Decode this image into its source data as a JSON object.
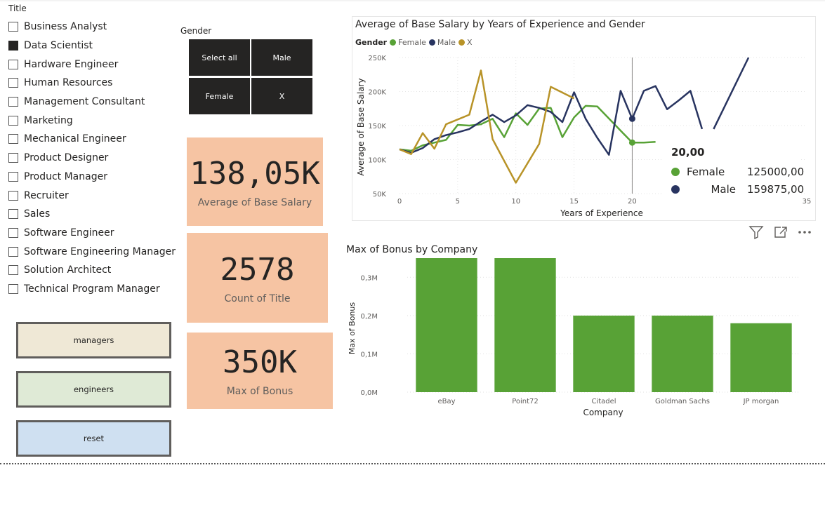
{
  "title_slicer": {
    "header": "Title",
    "items": [
      {
        "label": "Business Analyst",
        "checked": false
      },
      {
        "label": "Data Scientist",
        "checked": true
      },
      {
        "label": "Hardware Engineer",
        "checked": false
      },
      {
        "label": "Human Resources",
        "checked": false
      },
      {
        "label": "Management Consultant",
        "checked": false
      },
      {
        "label": "Marketing",
        "checked": false
      },
      {
        "label": "Mechanical Engineer",
        "checked": false
      },
      {
        "label": "Product Designer",
        "checked": false
      },
      {
        "label": "Product Manager",
        "checked": false
      },
      {
        "label": "Recruiter",
        "checked": false
      },
      {
        "label": "Sales",
        "checked": false
      },
      {
        "label": "Software Engineer",
        "checked": false
      },
      {
        "label": "Software Engineering Manager",
        "checked": false
      },
      {
        "label": "Solution Architect",
        "checked": false
      },
      {
        "label": "Technical Program Manager",
        "checked": false
      }
    ]
  },
  "gender_slicer": {
    "header": "Gender",
    "tiles": [
      "Select all",
      "Male",
      "Female",
      "X"
    ]
  },
  "buttons": {
    "managers": {
      "label": "managers",
      "color": "#efe8d6"
    },
    "engineers": {
      "label": "engineers",
      "color": "#dfead6"
    },
    "reset": {
      "label": "reset",
      "color": "#cfe0f1"
    }
  },
  "cards": {
    "avg_salary": {
      "value": "138,05K",
      "caption": "Average of Base Salary"
    },
    "count_title": {
      "value": "2578",
      "caption": "Count of Title"
    },
    "max_bonus": {
      "value": "350K",
      "caption": "Max of Bonus"
    },
    "color": "#f6c4a3"
  },
  "line_chart": {
    "title": "Average of Base Salary by Years of Experience and Gender",
    "legend_title": "Gender",
    "legend": [
      {
        "name": "Female",
        "color": "#58a236"
      },
      {
        "name": "Male",
        "color": "#283460"
      },
      {
        "name": "X",
        "color": "#b89328"
      }
    ],
    "tooltip": {
      "header": "20,00",
      "rows": [
        {
          "name": "Female",
          "value": "125000,00",
          "color": "#58a236"
        },
        {
          "name": "Male",
          "value": "159875,00",
          "color": "#283460"
        }
      ]
    }
  },
  "icons": {
    "filter": "filter-icon",
    "focus": "focus-mode-icon",
    "more": "more-options-icon"
  },
  "chart_data": [
    {
      "type": "line",
      "title": "Average of Base Salary by Years of Experience and Gender",
      "xlabel": "Years of Experience",
      "ylabel": "Average of Base Salary",
      "xlim": [
        0,
        35
      ],
      "ylim": [
        50000,
        250000
      ],
      "x_ticks": [
        "0",
        "5",
        "10",
        "15",
        "20",
        "35"
      ],
      "y_ticks": [
        "50K",
        "100K",
        "150K",
        "200K",
        "250K"
      ],
      "legend_position": "top-left",
      "hover_x": 20,
      "series": [
        {
          "name": "Female",
          "color": "#58a236",
          "points": [
            [
              0,
              115000
            ],
            [
              1,
              113000
            ],
            [
              2,
              121000
            ],
            [
              3,
              125000
            ],
            [
              4,
              129000
            ],
            [
              5,
              151000
            ],
            [
              6,
              150000
            ],
            [
              7,
              152000
            ],
            [
              8,
              160000
            ],
            [
              9,
              133000
            ],
            [
              10,
              168000
            ],
            [
              11,
              151000
            ],
            [
              12,
              175000
            ],
            [
              13,
              176000
            ],
            [
              14,
              133000
            ],
            [
              15,
              162000
            ],
            [
              16,
              179000
            ],
            [
              17,
              178000
            ],
            [
              20,
              125000
            ],
            [
              21,
              125000
            ],
            [
              22,
              126000
            ]
          ]
        },
        {
          "name": "Male",
          "color": "#283460",
          "segments": [
            [
              [
                0,
                115000
              ],
              [
                1,
                110000
              ],
              [
                2,
                117000
              ],
              [
                3,
                130000
              ],
              [
                4,
                136000
              ],
              [
                5,
                140000
              ],
              [
                6,
                145000
              ],
              [
                7,
                156000
              ],
              [
                8,
                166000
              ],
              [
                9,
                155000
              ],
              [
                10,
                165000
              ],
              [
                11,
                180000
              ],
              [
                12,
                176000
              ],
              [
                13,
                170000
              ],
              [
                14,
                155000
              ],
              [
                15,
                199000
              ],
              [
                16,
                160000
              ],
              [
                17,
                132000
              ],
              [
                18,
                107000
              ],
              [
                19,
                201000
              ],
              [
                20,
                160000
              ],
              [
                21,
                201000
              ],
              [
                22,
                208000
              ],
              [
                23,
                174000
              ],
              [
                24,
                187000
              ],
              [
                25,
                201000
              ],
              [
                26,
                145000
              ]
            ],
            [
              [
                27,
                145000
              ],
              [
                30,
                250000
              ]
            ]
          ]
        },
        {
          "name": "X",
          "color": "#b89328",
          "points": [
            [
              0,
              115000
            ],
            [
              1,
              108000
            ],
            [
              2,
              139000
            ],
            [
              3,
              116000
            ],
            [
              4,
              152000
            ],
            [
              5,
              159000
            ],
            [
              6,
              166000
            ],
            [
              7,
              231000
            ],
            [
              8,
              130000
            ],
            [
              10,
              66000
            ],
            [
              12,
              123000
            ],
            [
              13,
              207000
            ],
            [
              15,
              190000
            ]
          ]
        }
      ]
    },
    {
      "type": "bar",
      "title": "Max of Bonus by Company",
      "xlabel": "Company",
      "ylabel": "Max of Bonus",
      "ylim": [
        0,
        350000
      ],
      "y_ticks": [
        "0,0M",
        "0,1M",
        "0,2M",
        "0,3M"
      ],
      "categories": [
        "eBay",
        "Point72",
        "Citadel",
        "Goldman Sachs",
        "JP morgan"
      ],
      "values": [
        350000,
        350000,
        200000,
        200000,
        180000
      ],
      "color": "#58a236"
    }
  ]
}
